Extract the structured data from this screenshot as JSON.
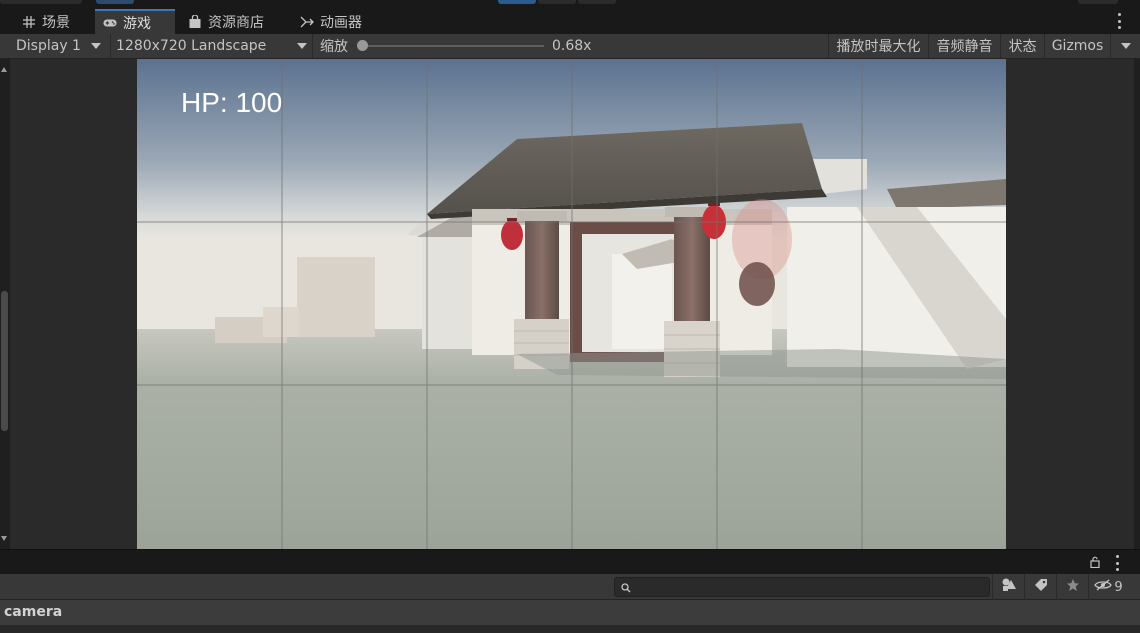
{
  "tabs": [
    {
      "label": "场景",
      "icon": "grid-icon"
    },
    {
      "label": "游戏",
      "icon": "gamepad-icon"
    },
    {
      "label": "资源商店",
      "icon": "bag-icon"
    },
    {
      "label": "动画器",
      "icon": "animator-icon"
    }
  ],
  "active_tab": "游戏",
  "toolbar": {
    "display": "Display 1",
    "resolution": "1280x720 Landscape",
    "zoom_label": "缩放",
    "zoom_value": "0.68x",
    "zoom_fraction": 0.0,
    "maximize": "播放时最大化",
    "mute": "音频静音",
    "stats": "状态",
    "gizmos": "Gizmos"
  },
  "game": {
    "hp_text": "HP: 100"
  },
  "hierarchy": {
    "search_placeholder": "",
    "visibility_count": "9",
    "selected_item": "camera"
  },
  "colors": {
    "accent": "#3a79bb",
    "panel": "#383838",
    "background": "#191919",
    "lantern": "#c0303a"
  }
}
